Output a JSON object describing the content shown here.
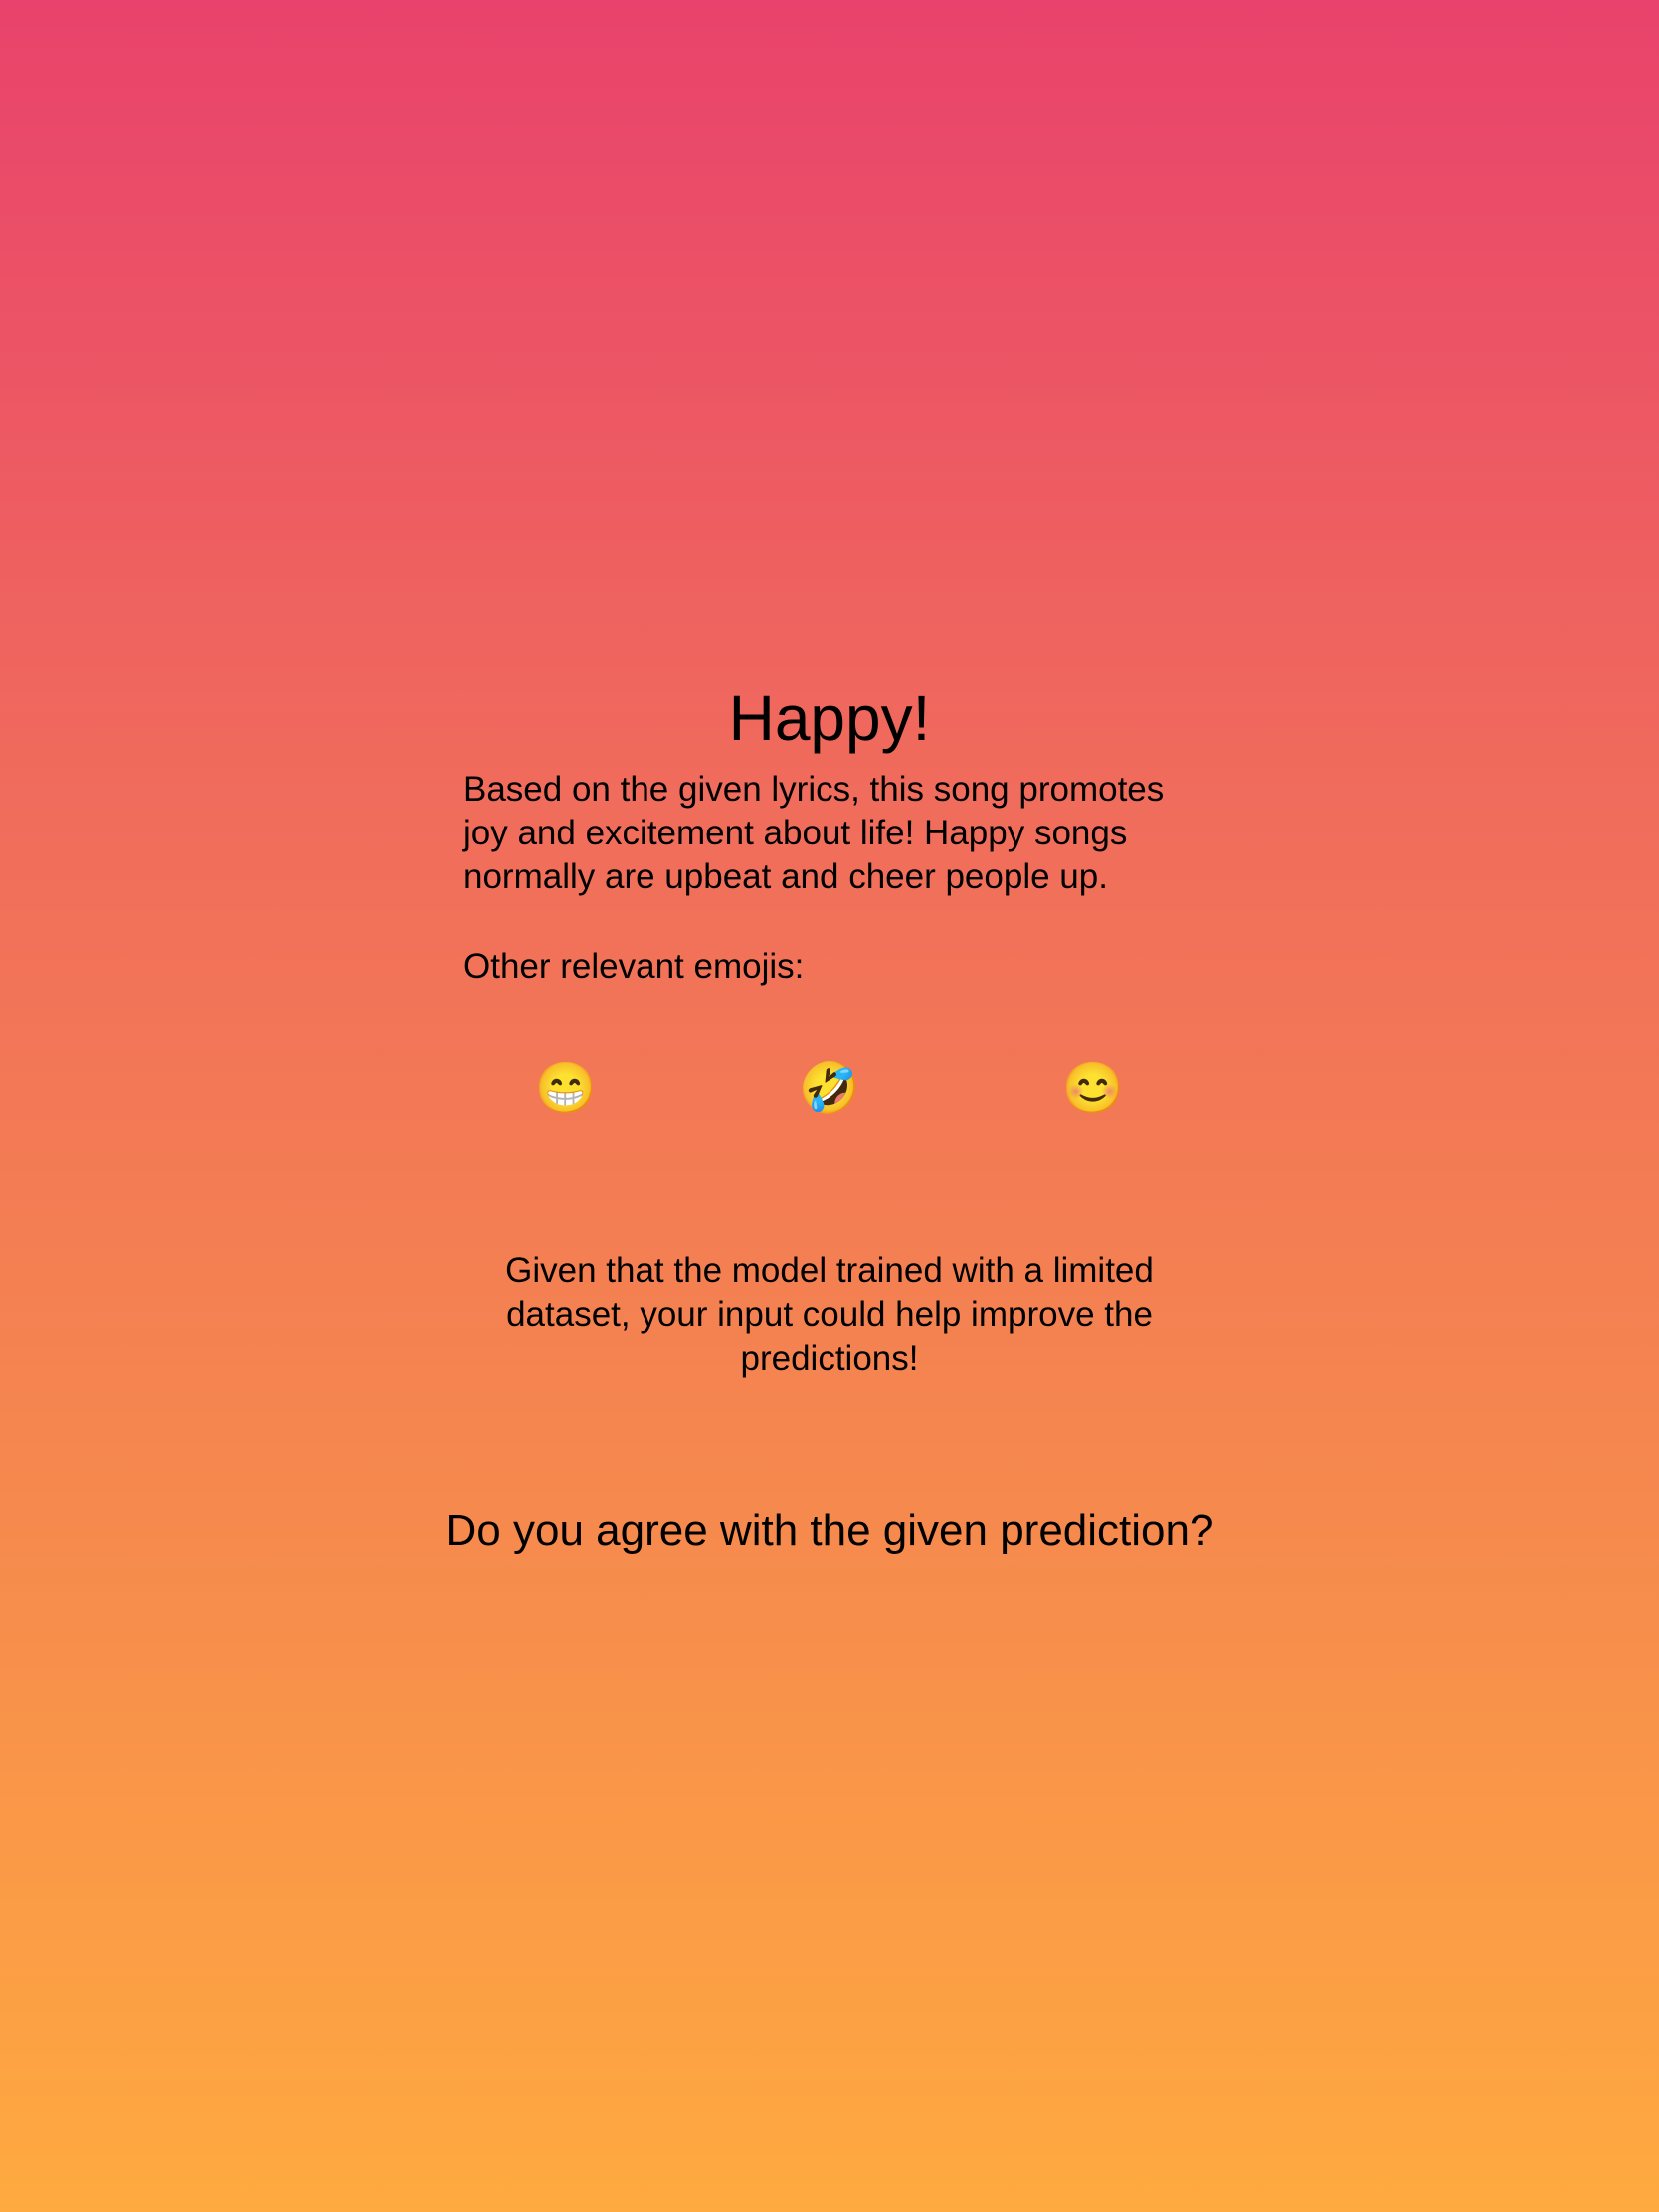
{
  "prediction": {
    "title": "Happy!",
    "description": "Based on the given lyrics, this song promotes joy and excitement about life! Happy songs normally are upbeat and cheer people up."
  },
  "emojis": {
    "heading": "Other relevant emojis:",
    "items": [
      {
        "glyph": "😁",
        "icon": "grinning-face-with-smiling-eyes-icon"
      },
      {
        "glyph": "🤣",
        "icon": "rolling-on-the-floor-laughing-icon"
      },
      {
        "glyph": "😊",
        "icon": "smiling-face-with-smiling-eyes-icon"
      }
    ]
  },
  "feedback": {
    "info": "Given that the model trained with a limited dataset, your input could help improve the predictions!",
    "question": "Do you agree with the given prediction?"
  },
  "theme": {
    "gradient_top": "#E9426C",
    "gradient_bottom": "#FFAA40",
    "text_color": "#000000"
  }
}
